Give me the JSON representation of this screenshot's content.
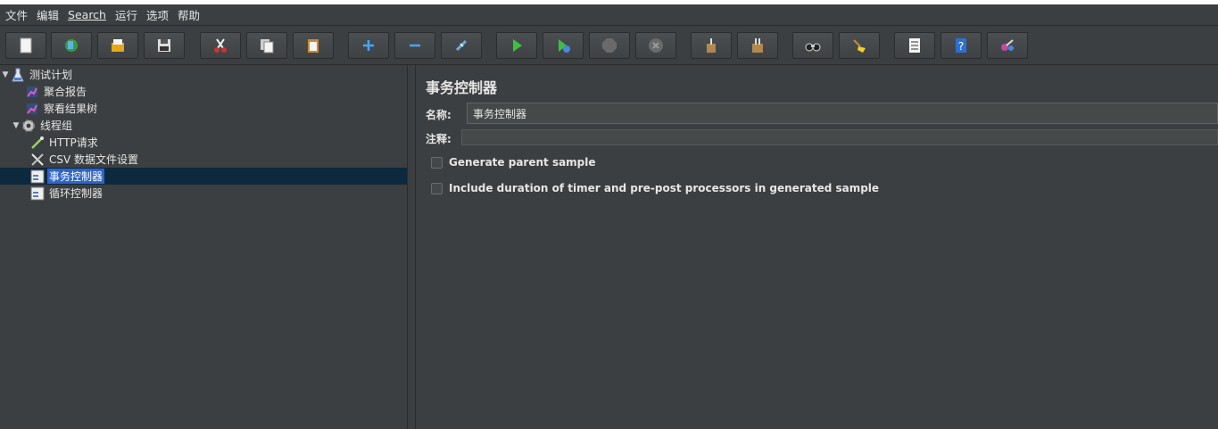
{
  "menu": {
    "file": "文件",
    "edit": "编辑",
    "search": "Search",
    "run": "运行",
    "options": "选项",
    "help": "帮助"
  },
  "toolbar": {
    "buttons": [
      {
        "name": "new-icon"
      },
      {
        "name": "templates-icon"
      },
      {
        "name": "open-icon"
      },
      {
        "name": "save-icon"
      },
      {
        "name": "cut-icon"
      },
      {
        "name": "copy-icon"
      },
      {
        "name": "paste-icon"
      },
      {
        "name": "expand-icon"
      },
      {
        "name": "collapse-icon"
      },
      {
        "name": "toggle-icon"
      },
      {
        "name": "start-icon"
      },
      {
        "name": "start-no-pauses-icon"
      },
      {
        "name": "stop-icon"
      },
      {
        "name": "shutdown-icon"
      },
      {
        "name": "clear-icon"
      },
      {
        "name": "clear-all-icon"
      },
      {
        "name": "search-icon"
      },
      {
        "name": "reset-search-icon"
      },
      {
        "name": "function-helper-icon"
      },
      {
        "name": "help-icon"
      },
      {
        "name": "remote-icon"
      }
    ]
  },
  "tree": {
    "items": [
      {
        "label": "测试计划",
        "icon": "test-plan-icon"
      },
      {
        "label": "聚合报告",
        "icon": "report-icon"
      },
      {
        "label": "察看结果树",
        "icon": "report-icon"
      },
      {
        "label": "线程组",
        "icon": "gear-icon"
      },
      {
        "label": "HTTP请求",
        "icon": "pipette-icon"
      },
      {
        "label": "CSV 数据文件设置",
        "icon": "tools-icon"
      },
      {
        "label": "事务控制器",
        "icon": "controller-icon"
      },
      {
        "label": "循环控制器",
        "icon": "controller-icon"
      }
    ]
  },
  "panel": {
    "title": "事务控制器",
    "name_label": "名称:",
    "name_value": "事务控制器",
    "comment_label": "注释:",
    "comment_value": "",
    "checkbox1": "Generate parent sample",
    "checkbox2": "Include duration of timer and pre-post processors in generated sample"
  },
  "colors": {
    "background": "#3c3f41",
    "selection": "#2f65ca",
    "selection_row": "#0d293e"
  }
}
